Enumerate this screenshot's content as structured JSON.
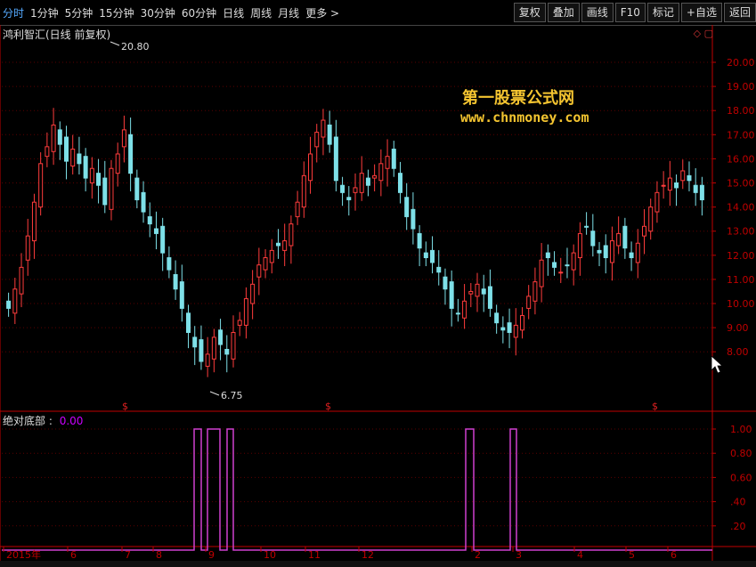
{
  "toolbar": {
    "periods": [
      "分时",
      "1分钟",
      "5分钟",
      "15分钟",
      "30分钟",
      "60分钟",
      "日线",
      "周线",
      "月线",
      "更多 >"
    ],
    "active_index": 0,
    "actions": [
      "复权",
      "叠加",
      "画线",
      "F10",
      "标记",
      "+自选",
      "返回"
    ]
  },
  "chart": {
    "title": "鸿利智汇(日线 前复权)",
    "high_label": "20.80",
    "low_label": "6.75",
    "watermark_line1": "第一股票公式网",
    "watermark_line2": "www.chnmoney.com",
    "dollar_marker": "$"
  },
  "indicator": {
    "name": "绝对底部",
    "value": "0.00",
    "sep": " : "
  },
  "colors": {
    "up": "#ff3c3c",
    "down": "#7ee0e8",
    "axis": "#c00000",
    "indicator": "#d040d0"
  },
  "chart_data": {
    "type": "candlestick",
    "price_axis": [
      "20.00",
      "19.00",
      "18.00",
      "17.00",
      "16.00",
      "15.00",
      "14.00",
      "13.00",
      "12.00",
      "11.00",
      "10.00",
      "9.00",
      "8.00"
    ],
    "indicator_axis": [
      "1.00",
      "0.80",
      "0.60",
      ".40",
      ".20"
    ],
    "date_axis": [
      "2015年",
      "6",
      "7",
      "8",
      "9",
      "10",
      "11",
      "12",
      "2",
      "3",
      "4",
      "5",
      "6"
    ],
    "close_path": [
      9.8,
      10.6,
      11.5,
      12.8,
      14.2,
      15.8,
      16.5,
      17.4,
      16.6,
      15.9,
      16.4,
      15.8,
      15.2,
      15.6,
      14.9,
      14.1,
      15.6,
      16.2,
      17.2,
      15.4,
      14.3,
      13.8,
      13.3,
      12.9,
      12.1,
      11.4,
      10.6,
      9.8,
      8.8,
      8.2,
      7.6,
      7.9,
      8.6,
      8.3,
      7.9,
      8.8,
      9.3,
      10.2,
      10.8,
      11.6,
      11.9,
      12.2,
      12.4,
      12.6,
      13.3,
      14.2,
      15.3,
      16.2,
      17.1,
      17.6,
      16.6,
      15.1,
      14.6,
      14.3,
      14.8,
      15.4,
      14.9,
      15.3,
      15.8,
      16.1,
      15.6,
      14.6,
      13.6,
      13.1,
      12.3,
      11.9,
      11.7,
      11.3,
      10.6,
      9.8,
      9.6,
      10.1,
      10.5,
      10.8,
      10.4,
      9.8,
      9.2,
      8.9,
      8.8,
      9.1,
      9.5,
      10.3,
      10.9,
      11.8,
      11.9,
      11.5,
      11.3,
      11.6,
      12.1,
      12.9,
      13.2,
      12.4,
      12.1,
      11.9,
      12.6,
      12.9,
      12.3,
      11.9,
      12.5,
      13.2,
      14.0,
      14.6,
      14.9,
      15.2,
      14.8,
      15.5,
      15.1,
      14.6,
      14.3
    ]
  }
}
